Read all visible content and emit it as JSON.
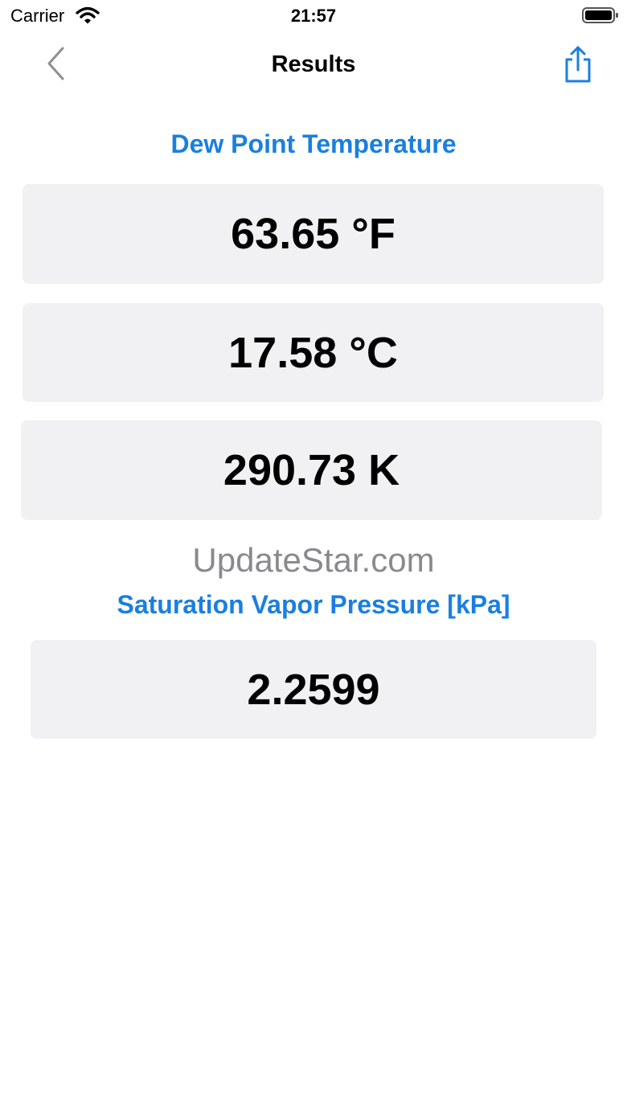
{
  "status_bar": {
    "carrier": "Carrier",
    "time": "21:57",
    "icons": [
      "wifi-icon",
      "battery-icon"
    ]
  },
  "nav": {
    "title": "Results",
    "back_icon": "chevron-left-icon",
    "share_icon": "share-icon"
  },
  "dew_point": {
    "title": "Dew Point Temperature",
    "values": [
      "63.65 °F",
      "17.58 °C",
      "290.73 K"
    ]
  },
  "watermark": "UpdateStar.com",
  "saturation": {
    "title": "Saturation Vapor Pressure [kPa]",
    "value": "2.2599"
  },
  "colors": {
    "accent": "#1a7fe0",
    "box_background": "#f1f1f4",
    "watermark": "#8a8a8e"
  }
}
